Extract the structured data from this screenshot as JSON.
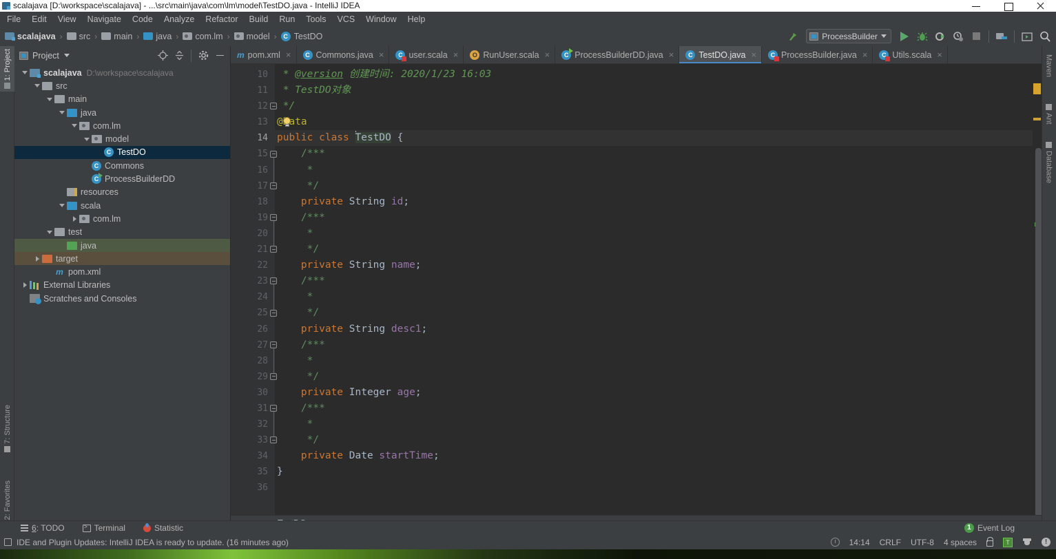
{
  "window": {
    "title": "scalajava [D:\\workspace\\scalajava] - ...\\src\\main\\java\\com\\lm\\model\\TestDO.java - IntelliJ IDEA",
    "controls": {
      "minimize": "minimize-button",
      "maximize": "maximize-button",
      "close": "close-button"
    }
  },
  "menubar": {
    "items": [
      "File",
      "Edit",
      "View",
      "Navigate",
      "Code",
      "Analyze",
      "Refactor",
      "Build",
      "Run",
      "Tools",
      "VCS",
      "Window",
      "Help"
    ]
  },
  "breadcrumb": {
    "items": [
      {
        "label": "scalajava",
        "icon": "project-module-icon",
        "bold": true
      },
      {
        "label": "src",
        "icon": "folder-icon"
      },
      {
        "label": "main",
        "icon": "folder-icon"
      },
      {
        "label": "java",
        "icon": "source-folder-icon"
      },
      {
        "label": "com.lm",
        "icon": "package-icon"
      },
      {
        "label": "model",
        "icon": "package-icon"
      },
      {
        "label": "TestDO",
        "icon": "class-icon"
      }
    ],
    "separator": "›"
  },
  "toolbar": {
    "run_config": "ProcessBuilder",
    "buttons": [
      {
        "name": "build-hammer-icon",
        "label": ""
      },
      {
        "name": "run-button",
        "label": ""
      },
      {
        "name": "debug-button",
        "label": ""
      },
      {
        "name": "run-coverage-button",
        "label": ""
      },
      {
        "name": "profile-button",
        "label": ""
      },
      {
        "name": "stop-button",
        "label": ""
      },
      {
        "name": "project-structure-button",
        "label": ""
      },
      {
        "name": "toggle-terminal-button",
        "label": ""
      },
      {
        "name": "search-everywhere-icon",
        "label": ""
      }
    ]
  },
  "left_rail": {
    "items": [
      {
        "label": "1: Project",
        "active": true
      },
      {
        "label": "7: Structure",
        "active": false
      },
      {
        "label": "2: Favorites",
        "active": false
      }
    ]
  },
  "right_rail": {
    "items": [
      {
        "label": "Maven"
      },
      {
        "label": "Ant"
      },
      {
        "label": "Database"
      }
    ]
  },
  "project_panel": {
    "title": "Project",
    "tools": [
      "locate-icon",
      "collapse-all-icon",
      "settings-gear-icon",
      "hide-icon"
    ],
    "tree": [
      {
        "label": "scalajava",
        "path": "D:\\workspace\\scalajava",
        "indent": 0,
        "arrow": "down",
        "icon": "project-module-icon",
        "bold": true,
        "state": ""
      },
      {
        "label": "src",
        "path": "",
        "indent": 1,
        "arrow": "down",
        "icon": "folder-icon",
        "bold": false,
        "state": ""
      },
      {
        "label": "main",
        "path": "",
        "indent": 2,
        "arrow": "down",
        "icon": "folder-icon",
        "bold": false,
        "state": ""
      },
      {
        "label": "java",
        "path": "",
        "indent": 3,
        "arrow": "down",
        "icon": "source-folder-icon",
        "bold": false,
        "state": ""
      },
      {
        "label": "com.lm",
        "path": "",
        "indent": 4,
        "arrow": "down",
        "icon": "package-icon",
        "bold": false,
        "state": ""
      },
      {
        "label": "model",
        "path": "",
        "indent": 5,
        "arrow": "down",
        "icon": "package-icon",
        "bold": false,
        "state": ""
      },
      {
        "label": "TestDO",
        "path": "",
        "indent": 6,
        "arrow": "none",
        "icon": "class-icon",
        "bold": false,
        "state": "selected"
      },
      {
        "label": "Commons",
        "path": "",
        "indent": 5,
        "arrow": "none",
        "icon": "class-icon",
        "bold": false,
        "state": ""
      },
      {
        "label": "ProcessBuilderDD",
        "path": "",
        "indent": 5,
        "arrow": "none",
        "icon": "runnable-class-icon",
        "bold": false,
        "state": ""
      },
      {
        "label": "resources",
        "path": "",
        "indent": 3,
        "arrow": "none",
        "icon": "resources-folder-icon",
        "bold": false,
        "state": ""
      },
      {
        "label": "scala",
        "path": "",
        "indent": 3,
        "arrow": "down",
        "icon": "source-folder-icon",
        "bold": false,
        "state": ""
      },
      {
        "label": "com.lm",
        "path": "",
        "indent": 4,
        "arrow": "right",
        "icon": "package-icon",
        "bold": false,
        "state": ""
      },
      {
        "label": "test",
        "path": "",
        "indent": 2,
        "arrow": "down",
        "icon": "folder-icon",
        "bold": false,
        "state": ""
      },
      {
        "label": "java",
        "path": "",
        "indent": 3,
        "arrow": "none",
        "icon": "test-source-folder-icon",
        "bold": false,
        "state": "green"
      },
      {
        "label": "target",
        "path": "",
        "indent": 1,
        "arrow": "right",
        "icon": "excluded-folder-icon",
        "bold": false,
        "state": "brown"
      },
      {
        "label": "pom.xml",
        "path": "",
        "indent": 2,
        "arrow": "none",
        "icon": "maven-file-icon",
        "bold": false,
        "state": ""
      },
      {
        "label": "External Libraries",
        "path": "",
        "indent": 0,
        "arrow": "right",
        "icon": "libraries-icon",
        "bold": false,
        "state": ""
      },
      {
        "label": "Scratches and Consoles",
        "path": "",
        "indent": 0,
        "arrow": "none",
        "icon": "scratches-icon",
        "bold": false,
        "state": ""
      }
    ]
  },
  "editor": {
    "tabs": [
      {
        "label": "pom.xml",
        "icon": "maven-file-icon",
        "active": false
      },
      {
        "label": "Commons.java",
        "icon": "class-icon",
        "active": false
      },
      {
        "label": "user.scala",
        "icon": "scala-class-icon",
        "active": false
      },
      {
        "label": "RunUser.scala",
        "icon": "scala-object-icon",
        "active": false
      },
      {
        "label": "ProcessBuilderDD.java",
        "icon": "runnable-class-icon",
        "active": false
      },
      {
        "label": "TestDO.java",
        "icon": "class-icon",
        "active": true
      },
      {
        "label": "ProcessBuilder.java",
        "icon": "scala-class-icon",
        "active": false
      },
      {
        "label": "Utils.scala",
        "icon": "scala-class-icon",
        "active": false
      }
    ],
    "close_glyph": "×",
    "first_line_number": 10,
    "current_line": 14,
    "breadcrumb": "TestDO",
    "lines": [
      {
        "n": 10,
        "tokens": [
          {
            "t": " * ",
            "c": "cm"
          },
          {
            "t": "@version",
            "c": "cmtag"
          },
          {
            "t": " 创建时间: 2020/1/23 16:03",
            "c": "cm"
          }
        ]
      },
      {
        "n": 11,
        "tokens": [
          {
            "t": " * TestDO对象",
            "c": "cm"
          }
        ]
      },
      {
        "n": 12,
        "tokens": [
          {
            "t": " */",
            "c": "cm"
          }
        ]
      },
      {
        "n": 13,
        "tokens": [
          {
            "t": "@Data",
            "c": "ann"
          }
        ]
      },
      {
        "n": 14,
        "tokens": [
          {
            "t": "public class ",
            "c": "kw"
          },
          {
            "t": "TestDO",
            "c": "sel"
          },
          {
            "t": " {",
            "c": "type"
          }
        ]
      },
      {
        "n": 15,
        "tokens": [
          {
            "t": "    /***",
            "c": "cmb"
          }
        ]
      },
      {
        "n": 16,
        "tokens": [
          {
            "t": "     *",
            "c": "cmb"
          }
        ]
      },
      {
        "n": 17,
        "tokens": [
          {
            "t": "     */",
            "c": "cmb"
          }
        ]
      },
      {
        "n": 18,
        "tokens": [
          {
            "t": "    private ",
            "c": "kw"
          },
          {
            "t": "String ",
            "c": "type"
          },
          {
            "t": "id",
            "c": "fld"
          },
          {
            "t": ";",
            "c": "type"
          }
        ]
      },
      {
        "n": 19,
        "tokens": [
          {
            "t": "    /***",
            "c": "cmb"
          }
        ]
      },
      {
        "n": 20,
        "tokens": [
          {
            "t": "     *",
            "c": "cmb"
          }
        ]
      },
      {
        "n": 21,
        "tokens": [
          {
            "t": "     */",
            "c": "cmb"
          }
        ]
      },
      {
        "n": 22,
        "tokens": [
          {
            "t": "    private ",
            "c": "kw"
          },
          {
            "t": "String ",
            "c": "type"
          },
          {
            "t": "name",
            "c": "fld"
          },
          {
            "t": ";",
            "c": "type"
          }
        ]
      },
      {
        "n": 23,
        "tokens": [
          {
            "t": "    /***",
            "c": "cmb"
          }
        ]
      },
      {
        "n": 24,
        "tokens": [
          {
            "t": "     *",
            "c": "cmb"
          }
        ]
      },
      {
        "n": 25,
        "tokens": [
          {
            "t": "     */",
            "c": "cmb"
          }
        ]
      },
      {
        "n": 26,
        "tokens": [
          {
            "t": "    private ",
            "c": "kw"
          },
          {
            "t": "String ",
            "c": "type"
          },
          {
            "t": "desc1",
            "c": "fld"
          },
          {
            "t": ";",
            "c": "type"
          }
        ]
      },
      {
        "n": 27,
        "tokens": [
          {
            "t": "    /***",
            "c": "cmb"
          }
        ]
      },
      {
        "n": 28,
        "tokens": [
          {
            "t": "     *",
            "c": "cmb"
          }
        ]
      },
      {
        "n": 29,
        "tokens": [
          {
            "t": "     */",
            "c": "cmb"
          }
        ]
      },
      {
        "n": 30,
        "tokens": [
          {
            "t": "    private ",
            "c": "kw"
          },
          {
            "t": "Integer ",
            "c": "type"
          },
          {
            "t": "age",
            "c": "fld"
          },
          {
            "t": ";",
            "c": "type"
          }
        ]
      },
      {
        "n": 31,
        "tokens": [
          {
            "t": "    /***",
            "c": "cmb"
          }
        ]
      },
      {
        "n": 32,
        "tokens": [
          {
            "t": "     *",
            "c": "cmb"
          }
        ]
      },
      {
        "n": 33,
        "tokens": [
          {
            "t": "     */",
            "c": "cmb"
          }
        ]
      },
      {
        "n": 34,
        "tokens": [
          {
            "t": "    private ",
            "c": "kw"
          },
          {
            "t": "Date ",
            "c": "type"
          },
          {
            "t": "startTime",
            "c": "fld"
          },
          {
            "t": ";",
            "c": "type"
          }
        ]
      },
      {
        "n": 35,
        "tokens": [
          {
            "t": "}",
            "c": "type"
          }
        ]
      },
      {
        "n": 36,
        "tokens": [
          {
            "t": "",
            "c": "type"
          }
        ]
      }
    ]
  },
  "bottom_toolbar": {
    "items": [
      {
        "label_prefix": "",
        "underlined": "6",
        "label": ": TODO",
        "icon": "todo-icon"
      },
      {
        "label_prefix": "",
        "underlined": "",
        "label": "Terminal",
        "icon": "terminal-icon"
      },
      {
        "label_prefix": "",
        "underlined": "",
        "label": "Statistic",
        "icon": "statistic-icon"
      }
    ],
    "event_log": {
      "count": "1",
      "label": "Event Log"
    }
  },
  "status_bar": {
    "message": "IDE and Plugin Updates: IntelliJ IDEA is ready to update. (16 minutes ago)",
    "time": "14:14",
    "line_separator": "CRLF",
    "encoding": "UTF-8",
    "indent": "4 spaces",
    "icons": [
      "clock-icon",
      "lock-icon",
      "translation-icon",
      "hat-icon",
      "notification-icon"
    ]
  },
  "colors": {
    "accent": "#4a88c7",
    "selection": "#0d293e",
    "keyword": "#cc7832",
    "comment": "#629755",
    "field": "#9876aa",
    "annotation": "#bbb529",
    "green_run": "#59a869"
  }
}
